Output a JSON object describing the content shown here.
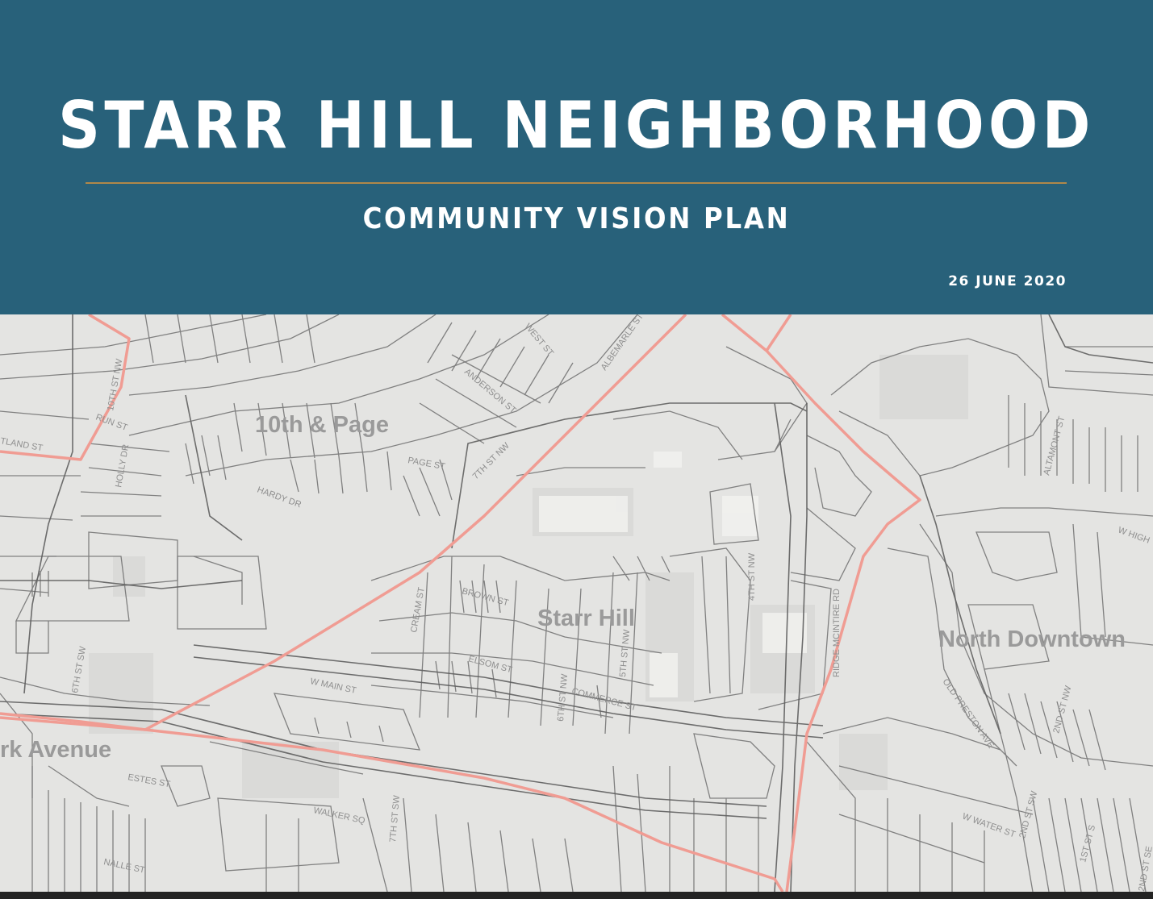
{
  "header": {
    "title": "STARR HILL NEIGHBORHOOD",
    "subtitle": "COMMUNITY VISION PLAN",
    "date": "26 JUNE 2020",
    "background_color": "#28617a",
    "rule_color": "#b1884a"
  },
  "map": {
    "neighborhood_labels": [
      "10th & Page",
      "Starr Hill",
      "North Downtown",
      "rk Avenue"
    ],
    "street_labels": [
      "10TH ST NW",
      "RUN ST",
      "TLAND ST",
      "HOLLY DR",
      "HARDY DR",
      "PAGE ST",
      "7TH ST NW",
      "ANDERSON ST",
      "WEST ST",
      "ALBEMARLE ST",
      "CREAM ST",
      "BROWN ST",
      "ELSOM ST",
      "COMMERCE ST",
      "W MAIN ST",
      "4TH ST NW",
      "5TH ST NW",
      "6TH ST NW",
      "6TH ST SW",
      "7TH ST SW",
      "ESTES ST",
      "WALKER SQ",
      "NALLE ST",
      "RIDGE MCINTIRE RD",
      "OLD PRESTON AVE",
      "2ND ST NW",
      "2ND ST SW",
      "1ST ST S",
      "W WATER ST",
      "ALTAMONT ST",
      "W HIGH",
      "2ND ST SE"
    ],
    "boundary_color": "#f09c93",
    "line_color": "#6f6f6f"
  }
}
